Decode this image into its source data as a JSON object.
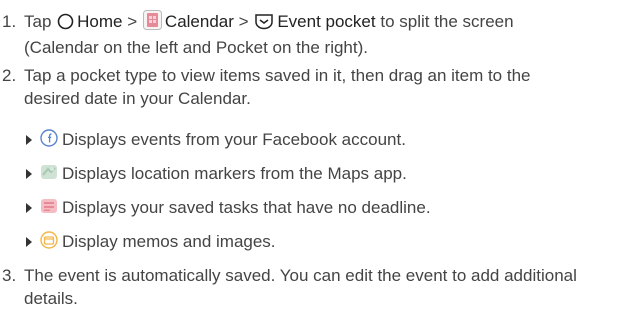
{
  "colors": {
    "text": "#444444",
    "emphasis": "#222222",
    "facebook_icon": "#5b84cf",
    "maps_icon": "#a8c8b0",
    "tasks_icon": "#e88a96",
    "memo_icon": "#f2b64a",
    "calendar_icon": "#e68a9a"
  },
  "steps": [
    {
      "number": "1.",
      "tap": "Tap",
      "home_icon": "home-circle-icon",
      "home_label": "Home",
      "sep1": ">",
      "calendar_icon": "calendar-app-icon",
      "calendar_label": "Calendar",
      "sep2": ">",
      "pocket_icon": "event-pocket-icon",
      "pocket_label": "Event pocket",
      "line1_rest": "to split the screen",
      "line2": "(Calendar on the left and Pocket on the right)."
    },
    {
      "number": "2.",
      "line1": "Tap a pocket type to view items saved in it, then drag an item to the",
      "line2": "desired date in your Calendar."
    },
    {
      "number": "3.",
      "line1": "The event is automatically saved. You can edit the event to add additional",
      "line2": "details."
    }
  ],
  "bullets": [
    {
      "icon": "facebook-icon",
      "text": "Displays events from your Facebook account."
    },
    {
      "icon": "maps-icon",
      "text": "Displays location markers from the Maps app."
    },
    {
      "icon": "tasks-icon",
      "text": "Displays your saved tasks that have no deadline."
    },
    {
      "icon": "memo-icon",
      "text": "Display memos and images."
    }
  ]
}
